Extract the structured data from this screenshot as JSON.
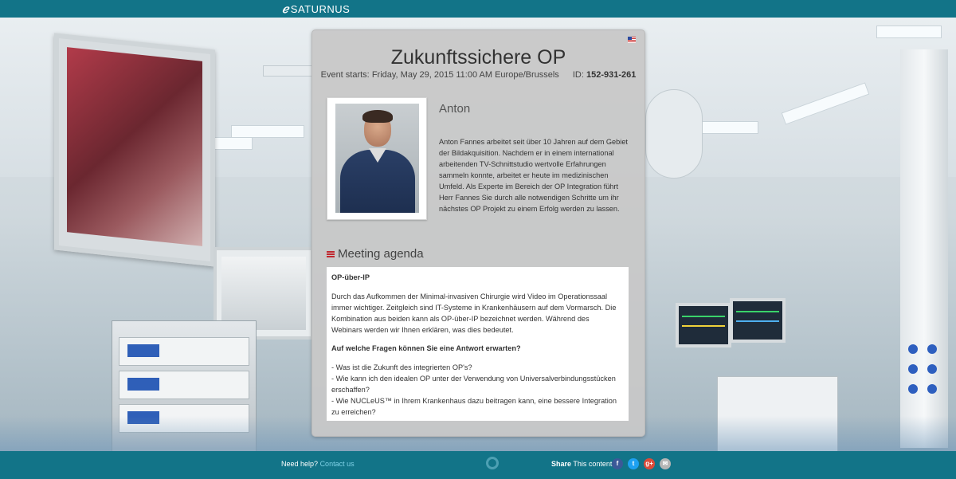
{
  "app": {
    "logo_text": "SATURNUS"
  },
  "event": {
    "title": "Zukunftssichere OP",
    "starts_label": "Event starts:",
    "starts_value": "Friday, May 29, 2015 11:00 AM Europe/Brussels",
    "id_label": "ID:",
    "id_value": "152-931-261",
    "language_flag": "us-flag-icon"
  },
  "speaker": {
    "name": "Anton",
    "bio": "Anton Fannes arbeitet seit über 10 Jahren auf dem Gebiet der Bildakquisition. Nachdem er in einem international arbeitenden TV-Schnittstudio wertvolle Erfahrungen sammeln konnte, arbeitet er heute im medizinischen Umfeld. Als Experte im Bereich der OP Integration führt Herr Fannes Sie durch alle notwendigen Schritte um ihr nächstes OP Projekt zu einem Erfolg werden zu lassen."
  },
  "agenda": {
    "heading": "Meeting agenda",
    "section1_title": "OP-über-IP",
    "section1_text": "Durch das Aufkommen der Minimal-invasiven Chirurgie wird Video im Operationssaal immer wichtiger. Zeitgleich sind IT-Systeme in Krankenhäusern auf dem Vormarsch. Die Kombination aus beiden kann als OP-über-IP bezeichnet werden. Während des Webinars werden wir Ihnen erklären, was dies bedeutet.",
    "section2_title": "Auf welche Fragen können Sie eine Antwort erwarten?",
    "questions": [
      "- Was ist die Zukunft des integrierten OP's?",
      "- Wie kann ich den idealen OP unter der Verwendung von Universalverbindungsstücken erschaffen?",
      "- Wie NUCLeUS™ in Ihrem Krankenhaus dazu beitragen kann, eine bessere Integration zu erreichen?"
    ]
  },
  "footer": {
    "help_label": "Need help?",
    "contact_link": "Contact us",
    "share_label": "Share",
    "share_text": "This content!",
    "social": [
      {
        "name": "facebook",
        "glyph": "f",
        "color": "#3b5998"
      },
      {
        "name": "twitter",
        "glyph": "t",
        "color": "#1da1f2"
      },
      {
        "name": "google-plus",
        "glyph": "g+",
        "color": "#dd4b39"
      },
      {
        "name": "email",
        "glyph": "✉",
        "color": "#b5b5b5"
      }
    ]
  },
  "colors": {
    "brand": "#127488",
    "link": "#7fd1e6",
    "agenda_icon": "#c0282f"
  }
}
